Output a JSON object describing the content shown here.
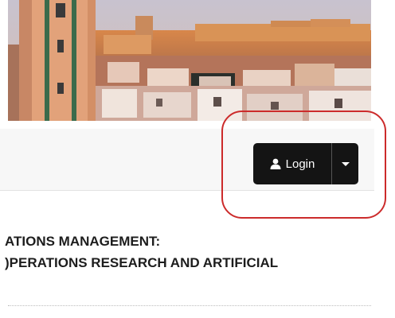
{
  "auth": {
    "login_label": "Login"
  },
  "icons": {
    "login_icon": "user-icon",
    "dropdown_icon": "caret-down-icon"
  },
  "content": {
    "title_line_1": "ATIONS MANAGEMENT:",
    "title_line_2": ")PERATIONS RESEARCH AND ARTIFICIAL"
  },
  "colors": {
    "button_background": "#141414",
    "annotation_red": "#cc2b2b"
  }
}
